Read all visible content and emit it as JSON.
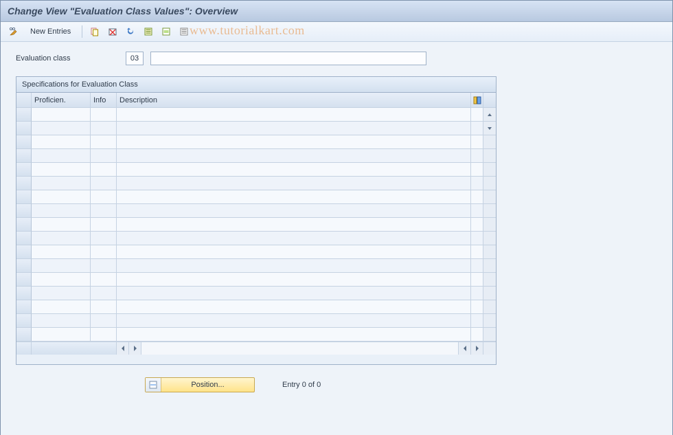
{
  "title": "Change View \"Evaluation Class Values\": Overview",
  "watermark": "www.tutorialkart.com",
  "toolbar": {
    "change_tooltip": "Change",
    "new_entries_label": "New Entries",
    "icon_buttons": [
      "copy",
      "delete",
      "undo",
      "select-all",
      "select-block",
      "deselect-all"
    ]
  },
  "field": {
    "label": "Evaluation class",
    "code": "03",
    "description": ""
  },
  "panel": {
    "title": "Specifications for Evaluation Class",
    "columns": {
      "proficiency": "Proficien.",
      "info": "Info",
      "description": "Description"
    },
    "row_count": 17,
    "rows": []
  },
  "footer": {
    "position_label": "Position...",
    "entry_text": "Entry 0 of 0"
  },
  "colors": {
    "header_grad_top": "#d7e3f4",
    "header_grad_bot": "#b8c9e0",
    "accent_yellow": "#ffe38a"
  }
}
